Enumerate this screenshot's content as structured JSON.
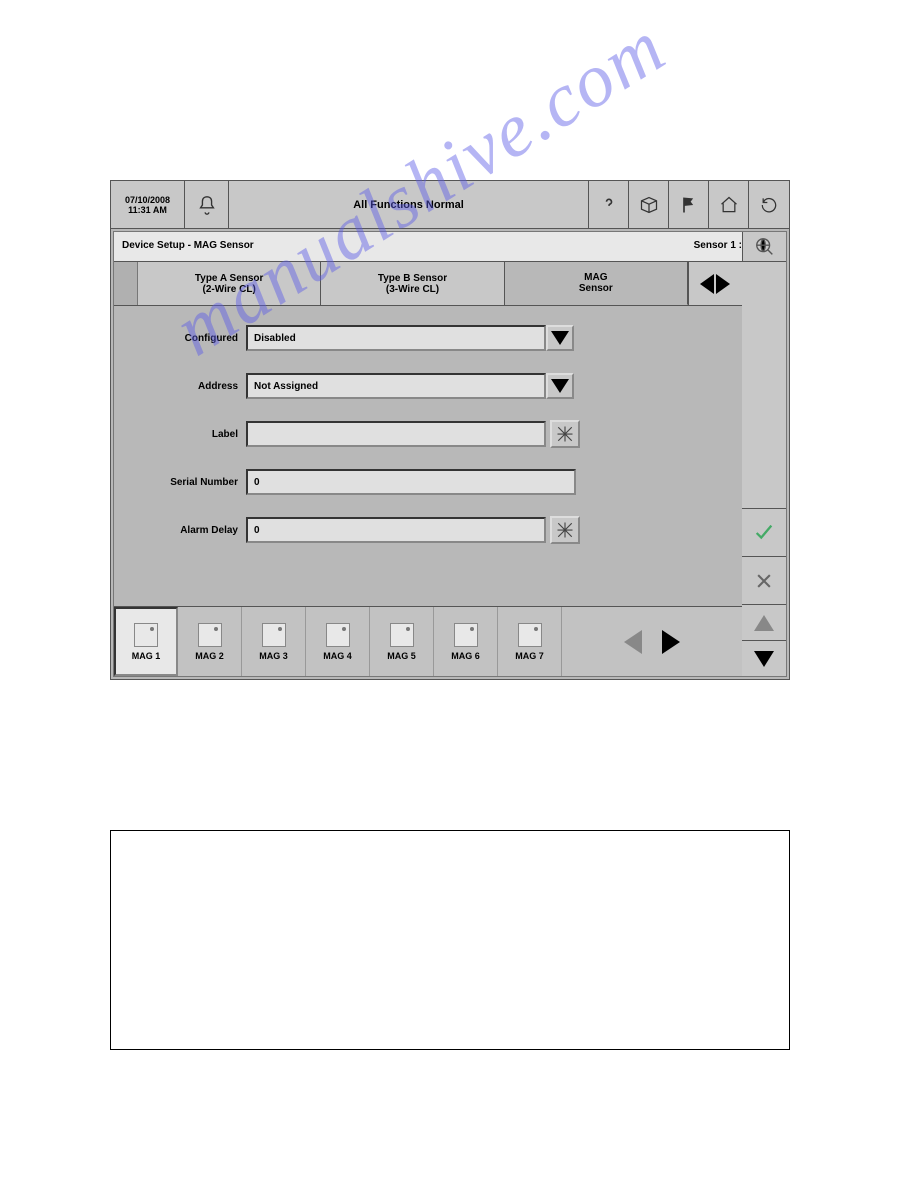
{
  "topbar": {
    "date": "07/10/2008",
    "time": "11:31 AM",
    "status": "All Functions Normal"
  },
  "inner": {
    "title": "Device Setup - MAG Sensor",
    "sensor_label": "Sensor 1 :"
  },
  "tabs": {
    "a_line1": "Type A Sensor",
    "a_line2": "(2-Wire CL)",
    "b_line1": "Type B Sensor",
    "b_line2": "(3-Wire CL)",
    "c_line1": "MAG",
    "c_line2": "Sensor"
  },
  "form": {
    "configured_label": "Configured",
    "configured_value": "Disabled",
    "address_label": "Address",
    "address_value": "Not Assigned",
    "label_label": "Label",
    "label_value": "",
    "serial_label": "Serial Number",
    "serial_value": "0",
    "delay_label": "Alarm Delay",
    "delay_value": "0"
  },
  "mags": [
    "MAG 1",
    "MAG 2",
    "MAG 3",
    "MAG 4",
    "MAG 5",
    "MAG 6",
    "MAG 7"
  ],
  "watermark": "manualshive.com"
}
